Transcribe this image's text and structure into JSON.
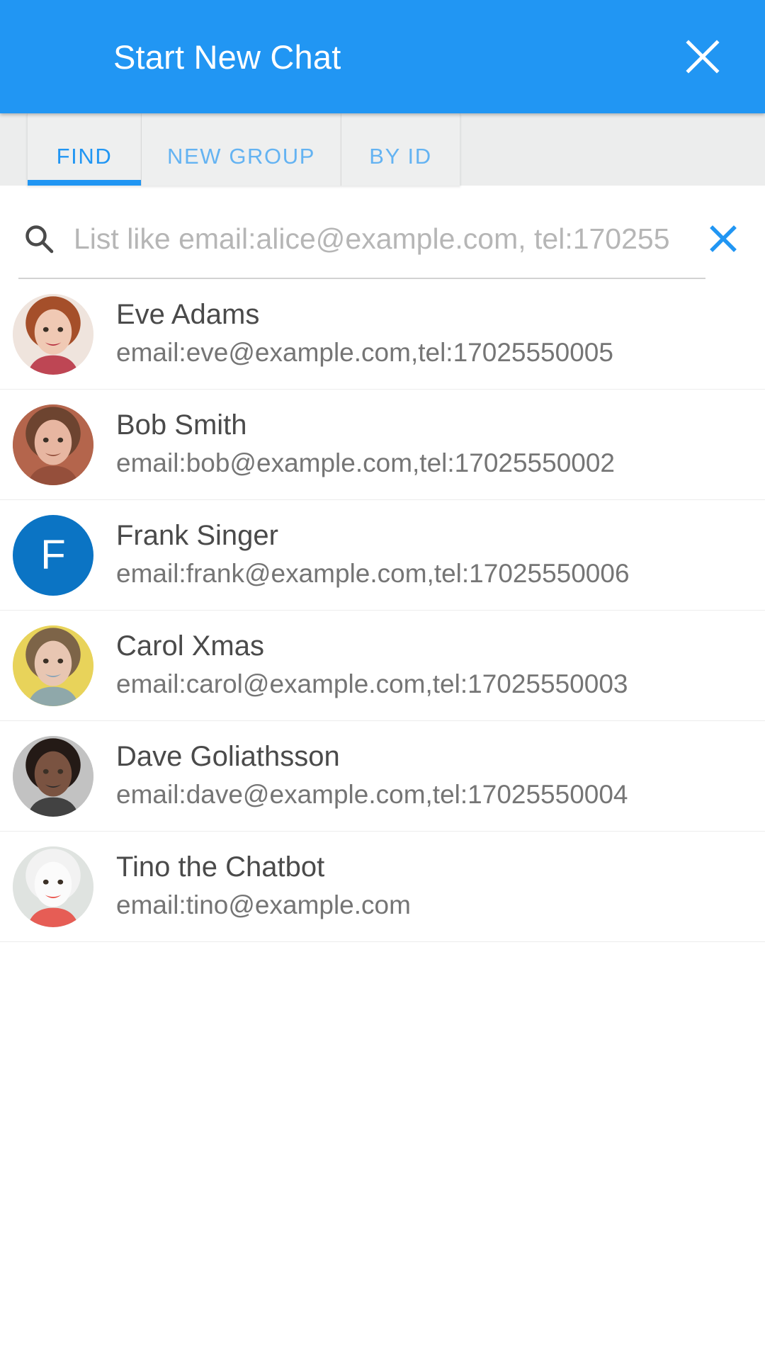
{
  "header": {
    "title": "Start New Chat",
    "close_label": "×",
    "bg_color": "#2196f3",
    "title_color": "#ffffff"
  },
  "tabs": {
    "active_index": 0,
    "active_color": "#2196f3",
    "inactive_color": "#64b3f2",
    "items": [
      {
        "label": "FIND"
      },
      {
        "label": "NEW GROUP"
      },
      {
        "label": "BY ID"
      }
    ]
  },
  "search": {
    "placeholder": "List like email:alice@example.com, tel:170255",
    "value": "",
    "icon": "search-icon",
    "clear_icon": "close-icon",
    "clear_color": "#2196f3"
  },
  "contacts": [
    {
      "name": "Eve Adams",
      "detail": "email:eve@example.com,tel:17025550005",
      "avatar_type": "photo",
      "avatar_desc": "woman-red-curly-hair-photo",
      "avatar_colors": {
        "bg": "#efe4dd",
        "hair": "#a54f2a",
        "skin": "#f0c9b4",
        "accent": "#b52a3c"
      }
    },
    {
      "name": "Bob Smith",
      "detail": "email:bob@example.com,tel:17025550002",
      "avatar_type": "photo",
      "avatar_desc": "man-fur-hat-brick-wall-photo",
      "avatar_colors": {
        "bg": "#b4654c",
        "hair": "#6d4430",
        "skin": "#e7b6a1",
        "accent": "#8f4b38"
      }
    },
    {
      "name": "Frank Singer",
      "detail": "email:frank@example.com,tel:17025550006",
      "avatar_type": "letter",
      "avatar_letter": "F",
      "avatar_colors": {
        "bg": "#0b74c4",
        "fg": "#ffffff"
      }
    },
    {
      "name": "Carol Xmas",
      "detail": "email:carol@example.com,tel:17025550003",
      "avatar_type": "photo",
      "avatar_desc": "woman-long-brown-hair-yellow-background-photo",
      "avatar_colors": {
        "bg": "#e8d35a",
        "hair": "#7d6448",
        "skin": "#e8c6b2",
        "accent": "#7fa0b8"
      }
    },
    {
      "name": "Dave Goliathsson",
      "detail": "email:dave@example.com,tel:17025550004",
      "avatar_type": "photo",
      "avatar_desc": "man-beard-glasses-grey-background-photo",
      "avatar_colors": {
        "bg": "#c2c2c2",
        "hair": "#241a16",
        "skin": "#7a5341",
        "accent": "#2b2b2b"
      }
    },
    {
      "name": "Tino the Chatbot",
      "detail": "email:tino@example.com",
      "avatar_type": "photo",
      "avatar_desc": "clown-face-red-nose-photo",
      "avatar_colors": {
        "bg": "#dfe3e0",
        "hair": "#f2f2f2",
        "skin": "#fbfbfb",
        "accent": "#e8453c"
      }
    }
  ]
}
